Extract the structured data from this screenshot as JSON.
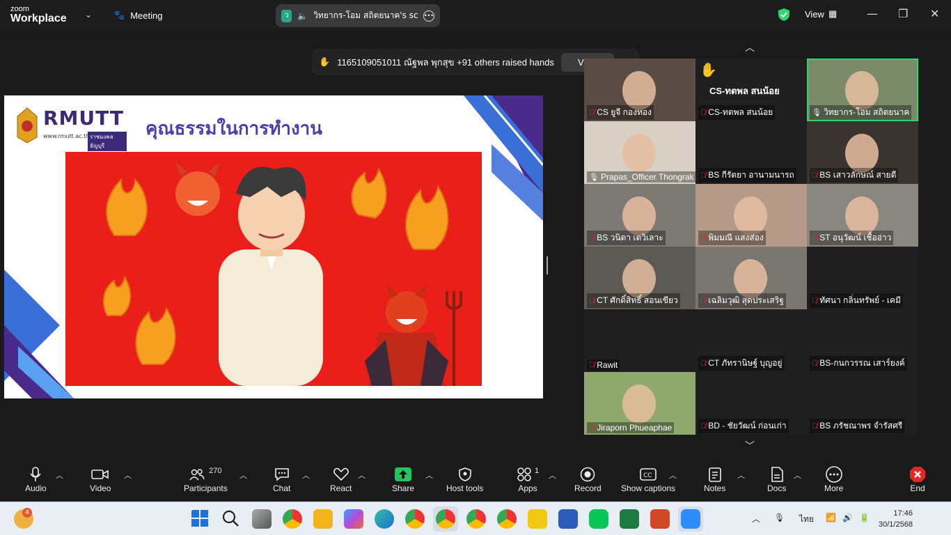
{
  "app": {
    "logo_top": "zoom",
    "logo_bottom": "Workplace",
    "meeting_label": "Meeting",
    "view_label": "View"
  },
  "share_pill": {
    "avatar_letter": "ว",
    "text": "วิทยากร-โอม สถิตยนาค's screen"
  },
  "notice": {
    "text": "1165109051011 ณัฐพล พุกสุข +91 others raised hands",
    "view_button": "View"
  },
  "slide": {
    "logo_text": "RMUTT",
    "logo_url": "www.rmutt.ac.th",
    "logo_sub": "ราชมงคลธัญบุรี",
    "title": "คุณธรรมในการทำงาน"
  },
  "participants": [
    {
      "name": "CS ยูจี กองทอง",
      "muted": true,
      "bg": "#5a4c45"
    },
    {
      "name": "CS-ทตพล สนน้อย",
      "muted": true,
      "bg": "#1f1f1f",
      "hand": true,
      "big_name": "CS-ทตพล สนน้อย"
    },
    {
      "name": "วิทยากร-โอม สถิตยนาค",
      "muted": false,
      "bg": "#7a8a6a",
      "active": true
    },
    {
      "name": "Prapas_Officer Thongrak",
      "muted": false,
      "bg": "#d8d0c4"
    },
    {
      "name": "BS กีรัตยา อานามนารถ",
      "muted": true,
      "bg": "#1f1f1f"
    },
    {
      "name": "BS เสาวลักษณ์ สายดี",
      "muted": true,
      "bg": "#3a3430"
    },
    {
      "name": "BS วนิดา เตวิเลาะ",
      "muted": true,
      "bg": "#7d7a76"
    },
    {
      "name": "พิมมณี แสงส่อง",
      "muted": true,
      "bg": "#b59a8a"
    },
    {
      "name": "ST อนุวัฒน์ เชื้ออ่าว",
      "muted": true,
      "bg": "#8a8680"
    },
    {
      "name": "CT ศักดิ์สิทธิ์ สอนเขียว",
      "muted": true,
      "bg": "#5b5a55"
    },
    {
      "name": "เฉลิมวุฒิ สุดประเสริฐ",
      "muted": true,
      "bg": "#7a7670"
    },
    {
      "name": "ทัศนา กลิ่นทรัพย์ - เคมี",
      "muted": true,
      "bg": "#1f1f1f"
    },
    {
      "name": "Rawit",
      "muted": true,
      "bg": "#1f1f1f"
    },
    {
      "name": "CT ภัทรานิษฐ์ บุญอยู่",
      "muted": true,
      "bg": "#1f1f1f"
    },
    {
      "name": "BS-กนกวรรณ เสาร์ยงค์",
      "muted": true,
      "bg": "#1f1f1f"
    },
    {
      "name": "Jiraporn Phueaphae",
      "muted": true,
      "bg": "#8ea86e"
    },
    {
      "name": "BD - ชัยวัฒน์ ก่อนเก่า",
      "muted": true,
      "bg": "#1f1f1f"
    },
    {
      "name": "BS ภรัชณาพร จำรัสศรี",
      "muted": true,
      "bg": "#1f1f1f"
    }
  ],
  "toolbar": {
    "audio": "Audio",
    "video": "Video",
    "participants": "Participants",
    "participants_count": "270",
    "chat": "Chat",
    "react": "React",
    "share": "Share",
    "host_tools": "Host tools",
    "apps": "Apps",
    "apps_count": "1",
    "record": "Record",
    "captions": "Show captions",
    "notes": "Notes",
    "docs": "Docs",
    "more": "More",
    "end": "End"
  },
  "taskbar": {
    "weather_badge": "4",
    "lang": "ไทย",
    "time": "17:46",
    "date": "30/1/2568"
  },
  "colors": {
    "accent_green": "#2bd96a",
    "end_red": "#e02828",
    "share_green": "#22c55e"
  }
}
